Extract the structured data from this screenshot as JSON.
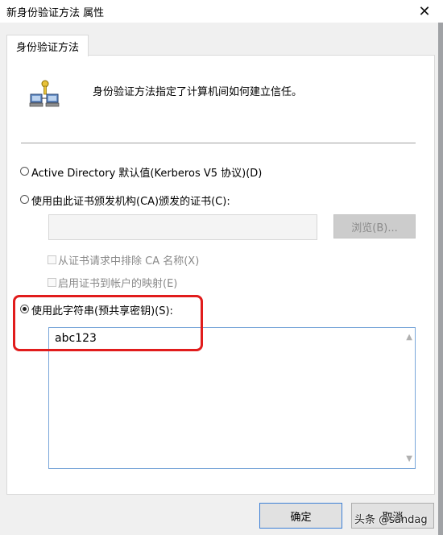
{
  "window": {
    "title": "新身份验证方法 属性",
    "close_glyph": "✕"
  },
  "tab": {
    "label": "身份验证方法"
  },
  "header": {
    "description": "身份验证方法指定了计算机间如何建立信任。"
  },
  "options": {
    "ad_label": "Active Directory 默认值(Kerberos V5 协议)(D)",
    "cert_label": "使用由此证书颁发机构(CA)颁发的证书(C):",
    "cert_value": "",
    "browse_label": "浏览(B)...",
    "exclude_ca_label": "从证书请求中排除 CA 名称(X)",
    "cert_mapping_label": "启用证书到帐户的映射(E)",
    "psk_label": "使用此字符串(预共享密钥)(S):",
    "psk_value": "abc123",
    "selected": "psk"
  },
  "buttons": {
    "ok_label": "确定",
    "cancel_label": "取消"
  },
  "watermark": "头条 @sandag",
  "colors": {
    "highlight": "#e11c1c",
    "focus_border": "#3c7fd6"
  }
}
